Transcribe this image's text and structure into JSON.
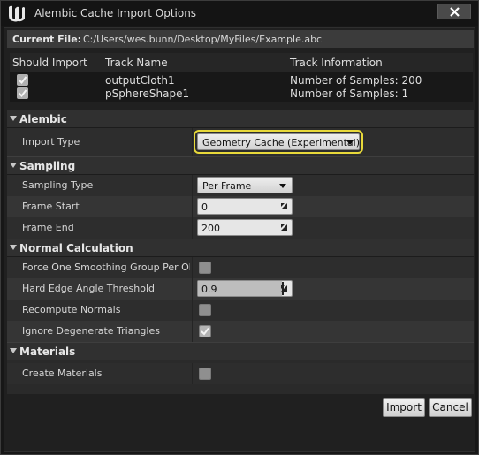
{
  "window": {
    "title": "Alembic Cache Import Options",
    "close_icon": "close-icon",
    "logo_icon": "unreal-logo-icon"
  },
  "current_file": {
    "label": "Current File:",
    "value": "C:/Users/wes.bunn/Desktop/MyFiles/Example.abc"
  },
  "tracks": {
    "columns": [
      "Should Import",
      "Track Name",
      "Track Information"
    ],
    "rows": [
      {
        "checked": true,
        "name": "outputCloth1",
        "info": "Number of Samples: 200"
      },
      {
        "checked": true,
        "name": "pSphereShape1",
        "info": "Number of Samples: 1"
      }
    ]
  },
  "categories": {
    "alembic": {
      "label": "Alembic",
      "import_type": {
        "label": "Import Type",
        "value": "Geometry Cache (Experimental)"
      }
    },
    "sampling": {
      "label": "Sampling",
      "sampling_type": {
        "label": "Sampling Type",
        "value": "Per Frame"
      },
      "frame_start": {
        "label": "Frame Start",
        "value": "0"
      },
      "frame_end": {
        "label": "Frame End",
        "value": "200"
      }
    },
    "normal_calculation": {
      "label": "Normal Calculation",
      "force_smoothing": {
        "label": "Force One Smoothing Group Per Object",
        "checked": false
      },
      "hard_edge": {
        "label": "Hard Edge Angle Threshold",
        "value": "0.9",
        "fraction": 0.9
      },
      "recompute_normals": {
        "label": "Recompute Normals",
        "checked": false
      },
      "ignore_degenerate": {
        "label": "Ignore Degenerate Triangles",
        "checked": true
      }
    },
    "materials": {
      "label": "Materials",
      "create_materials": {
        "label": "Create Materials",
        "checked": false
      }
    }
  },
  "buttons": {
    "import": "Import",
    "cancel": "Cancel"
  },
  "colors": {
    "focus_outline": "#e8d93a",
    "background": "#202020",
    "category": "#303030"
  }
}
